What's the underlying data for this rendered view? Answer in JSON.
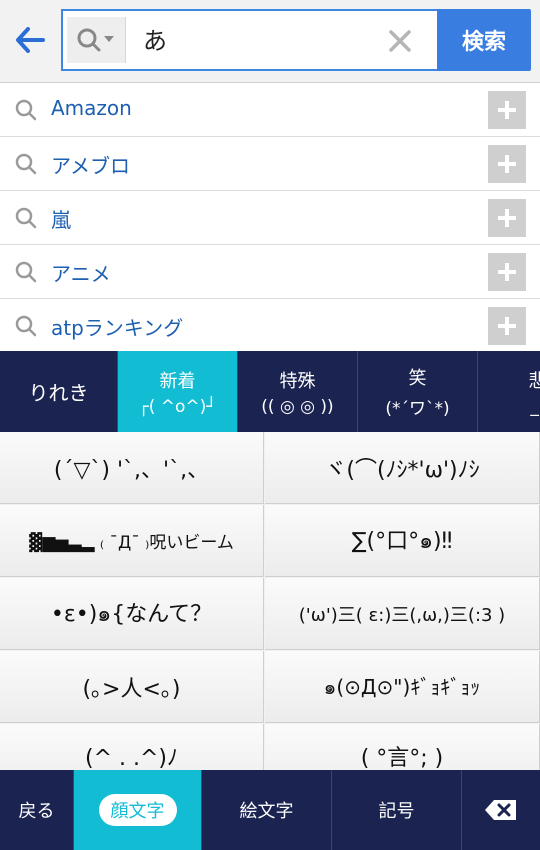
{
  "search": {
    "query": "あ",
    "button_label": "検索"
  },
  "suggestions": [
    {
      "text": "Amazon"
    },
    {
      "text": "アメブロ"
    },
    {
      "text": "嵐"
    },
    {
      "text": "アニメ"
    },
    {
      "text": "atpランキング"
    }
  ],
  "categories": [
    {
      "label": "りれき",
      "emoticon": ""
    },
    {
      "label": "新着",
      "emoticon": "┌( ^o^)┘"
    },
    {
      "label": "特殊",
      "emoticon": "(( ◎ ◎ ))"
    },
    {
      "label": "笑",
      "emoticon": "(*´ワ`*)"
    },
    {
      "label": "悲",
      "emoticon": "_|"
    }
  ],
  "emoticons": [
    "(´▽`) '`,、'`,、",
    "ヾ(⌒(ﾉｼ*'ω')ﾉｼ",
    "▓▆▅▃▂ ₍ ¯Д¯ ₎呪いビーム",
    "∑(°口°๑)‼",
    "•ε•)๑{なんて？",
    "('ω')三( ε:)三(,ω,)三(:3 )",
    "(｡>人<｡)",
    "๑(⊙Д⊙\")ｷﾞｮｷﾞｮｯ",
    "(^ . .^)ﾉ",
    "( °言°; )"
  ],
  "bottom": {
    "back": "戻る",
    "kaomoji": "顔文字",
    "emoji": "絵文字",
    "symbols": "記号"
  },
  "colors": {
    "accent": "#12bcd3",
    "nav_bg": "#1b2350",
    "link": "#1d5fb0",
    "search_button": "#3a7de0"
  }
}
